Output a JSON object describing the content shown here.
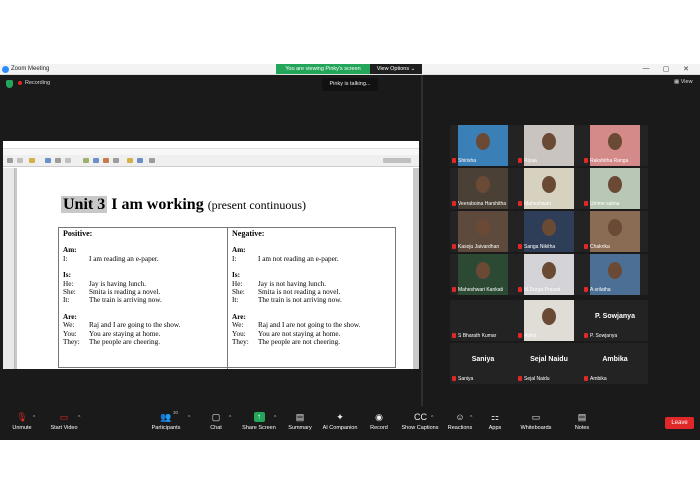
{
  "window": {
    "title": "Zoom Meeting",
    "viewing_banner": "You are viewing Pinky's screen",
    "view_options": "View Options",
    "min_glyph": "—",
    "max_glyph": "▢",
    "close_glyph": "✕"
  },
  "meeting": {
    "recording_label": "Recording",
    "talking_label": "Pinky is talking...",
    "view_label": "View"
  },
  "document": {
    "unit_number": "Unit 3",
    "unit_title": "I am working",
    "unit_subtitle": "(present continuous)",
    "positive": {
      "header": "Positive:",
      "sections": [
        {
          "label": "Am:",
          "rows": [
            [
              "I:",
              "I am reading an e-paper."
            ]
          ]
        },
        {
          "label": "Is:",
          "rows": [
            [
              "He:",
              "Jay is having lunch."
            ],
            [
              "She:",
              "Smita is reading a novel."
            ],
            [
              "It:",
              "The train is arriving now."
            ]
          ]
        },
        {
          "label": "Are:",
          "rows": [
            [
              "We:",
              "Raj and I are going to the show."
            ],
            [
              "You:",
              "You are staying at home."
            ],
            [
              "They:",
              "The people are cheering."
            ]
          ]
        }
      ]
    },
    "negative": {
      "header": "Negative:",
      "sections": [
        {
          "label": "Am:",
          "rows": [
            [
              "I:",
              "I am not reading an e-paper."
            ]
          ]
        },
        {
          "label": "Is:",
          "rows": [
            [
              "He:",
              "Jay is not having lunch."
            ],
            [
              "She:",
              "Smita is not reading a novel."
            ],
            [
              "It:",
              "The train is not arriving now."
            ]
          ]
        },
        {
          "label": "Are:",
          "rows": [
            [
              "We:",
              "Raj and I are not going to the show."
            ],
            [
              "You:",
              "You are not staying at home."
            ],
            [
              "They:",
              "The people are not cheering."
            ]
          ]
        }
      ]
    }
  },
  "participants": [
    {
      "name": "Shirisha",
      "video": true,
      "color": "#3a7fb5"
    },
    {
      "name": "Riyaa",
      "video": true,
      "color": "#c9c4bf"
    },
    {
      "name": "Rakshitha Ranga",
      "video": true,
      "color": "#d58a8a"
    },
    {
      "name": "Veeraboina Harshitha",
      "video": true,
      "color": "#4a4036"
    },
    {
      "name": "Maheshwari",
      "video": true,
      "color": "#d7d1bf"
    },
    {
      "name": "Umme salma",
      "video": true,
      "color": "#b9c8b6"
    },
    {
      "name": "Kasoju Jaivardhan",
      "video": true,
      "color": "#5e4a3c"
    },
    {
      "name": "Sanga Nikitha",
      "video": true,
      "color": "#2e3e58"
    },
    {
      "name": "Chakrika",
      "video": true,
      "color": "#8a6b53"
    },
    {
      "name": "Maheshwari Kankati",
      "video": true,
      "color": "#2c4a33"
    },
    {
      "name": "M.Durga Prasad",
      "video": true,
      "color": "#d3d3d8"
    },
    {
      "name": "A srilatha",
      "video": true,
      "color": "#4c6f96"
    },
    {
      "name": "S Bharath Kumar",
      "video": false,
      "big": ""
    },
    {
      "name": "Aisha",
      "video": true,
      "color": "#e0dcd6"
    },
    {
      "name": "P. Sowjanya",
      "video": false,
      "big": "P. Sowjanya"
    },
    {
      "name": "Saniya",
      "video": false,
      "big": "Saniya"
    },
    {
      "name": "Sejal Naidu",
      "video": false,
      "big": "Sejal Naidu"
    },
    {
      "name": "Ambika",
      "video": false,
      "big": "Ambika"
    }
  ],
  "toolbar": {
    "unmute": "Unmute",
    "start_video": "Start Video",
    "participants": "Participants",
    "participants_count": "30",
    "chat": "Chat",
    "share_screen": "Share Screen",
    "summary": "Summary",
    "ai_companion": "AI Companion",
    "record": "Record",
    "show_captions": "Show Captions",
    "reactions": "Reactions",
    "apps": "Apps",
    "whiteboards": "Whiteboards",
    "notes": "Notes",
    "leave": "Leave"
  },
  "colors": {
    "accent_green": "#23a55a",
    "leave_red": "#e02828",
    "background": "#1a1a1a"
  }
}
